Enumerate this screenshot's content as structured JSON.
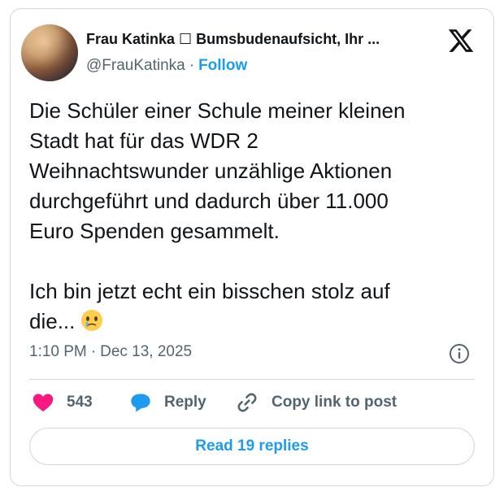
{
  "author": {
    "display_name": "Frau Katinka ☐ Bumsbudenaufsicht, Ihr ...",
    "handle": "@FrauKatinka",
    "separator": "·",
    "follow_label": "Follow"
  },
  "tweet": {
    "text": "Die Schüler einer Schule meiner kleinen\nStadt hat für das WDR 2\nWeihnachtswunder unzählige Aktionen\ndurchgeführt und dadurch über 11.000\nEuro Spenden gesammelt.\n\nIch bin jetzt echt ein bisschen stolz auf\ndie...",
    "emoji_icon": "face-holding-back-tears-icon",
    "time": "1:10 PM",
    "date": "Dec 13, 2025",
    "separator": "·"
  },
  "actions": {
    "like_count": "543",
    "reply_label": "Reply",
    "copy_link_label": "Copy link to post"
  },
  "read_replies_label": "Read 19 replies",
  "icons": [
    "x-logo-icon",
    "info-icon",
    "heart-icon",
    "reply-bubble-icon",
    "link-icon"
  ],
  "colors": {
    "accent": "#1d9bf0",
    "like": "#f91880",
    "muted_text": "#536471",
    "border": "#cfd9de",
    "text": "#0f1419"
  }
}
